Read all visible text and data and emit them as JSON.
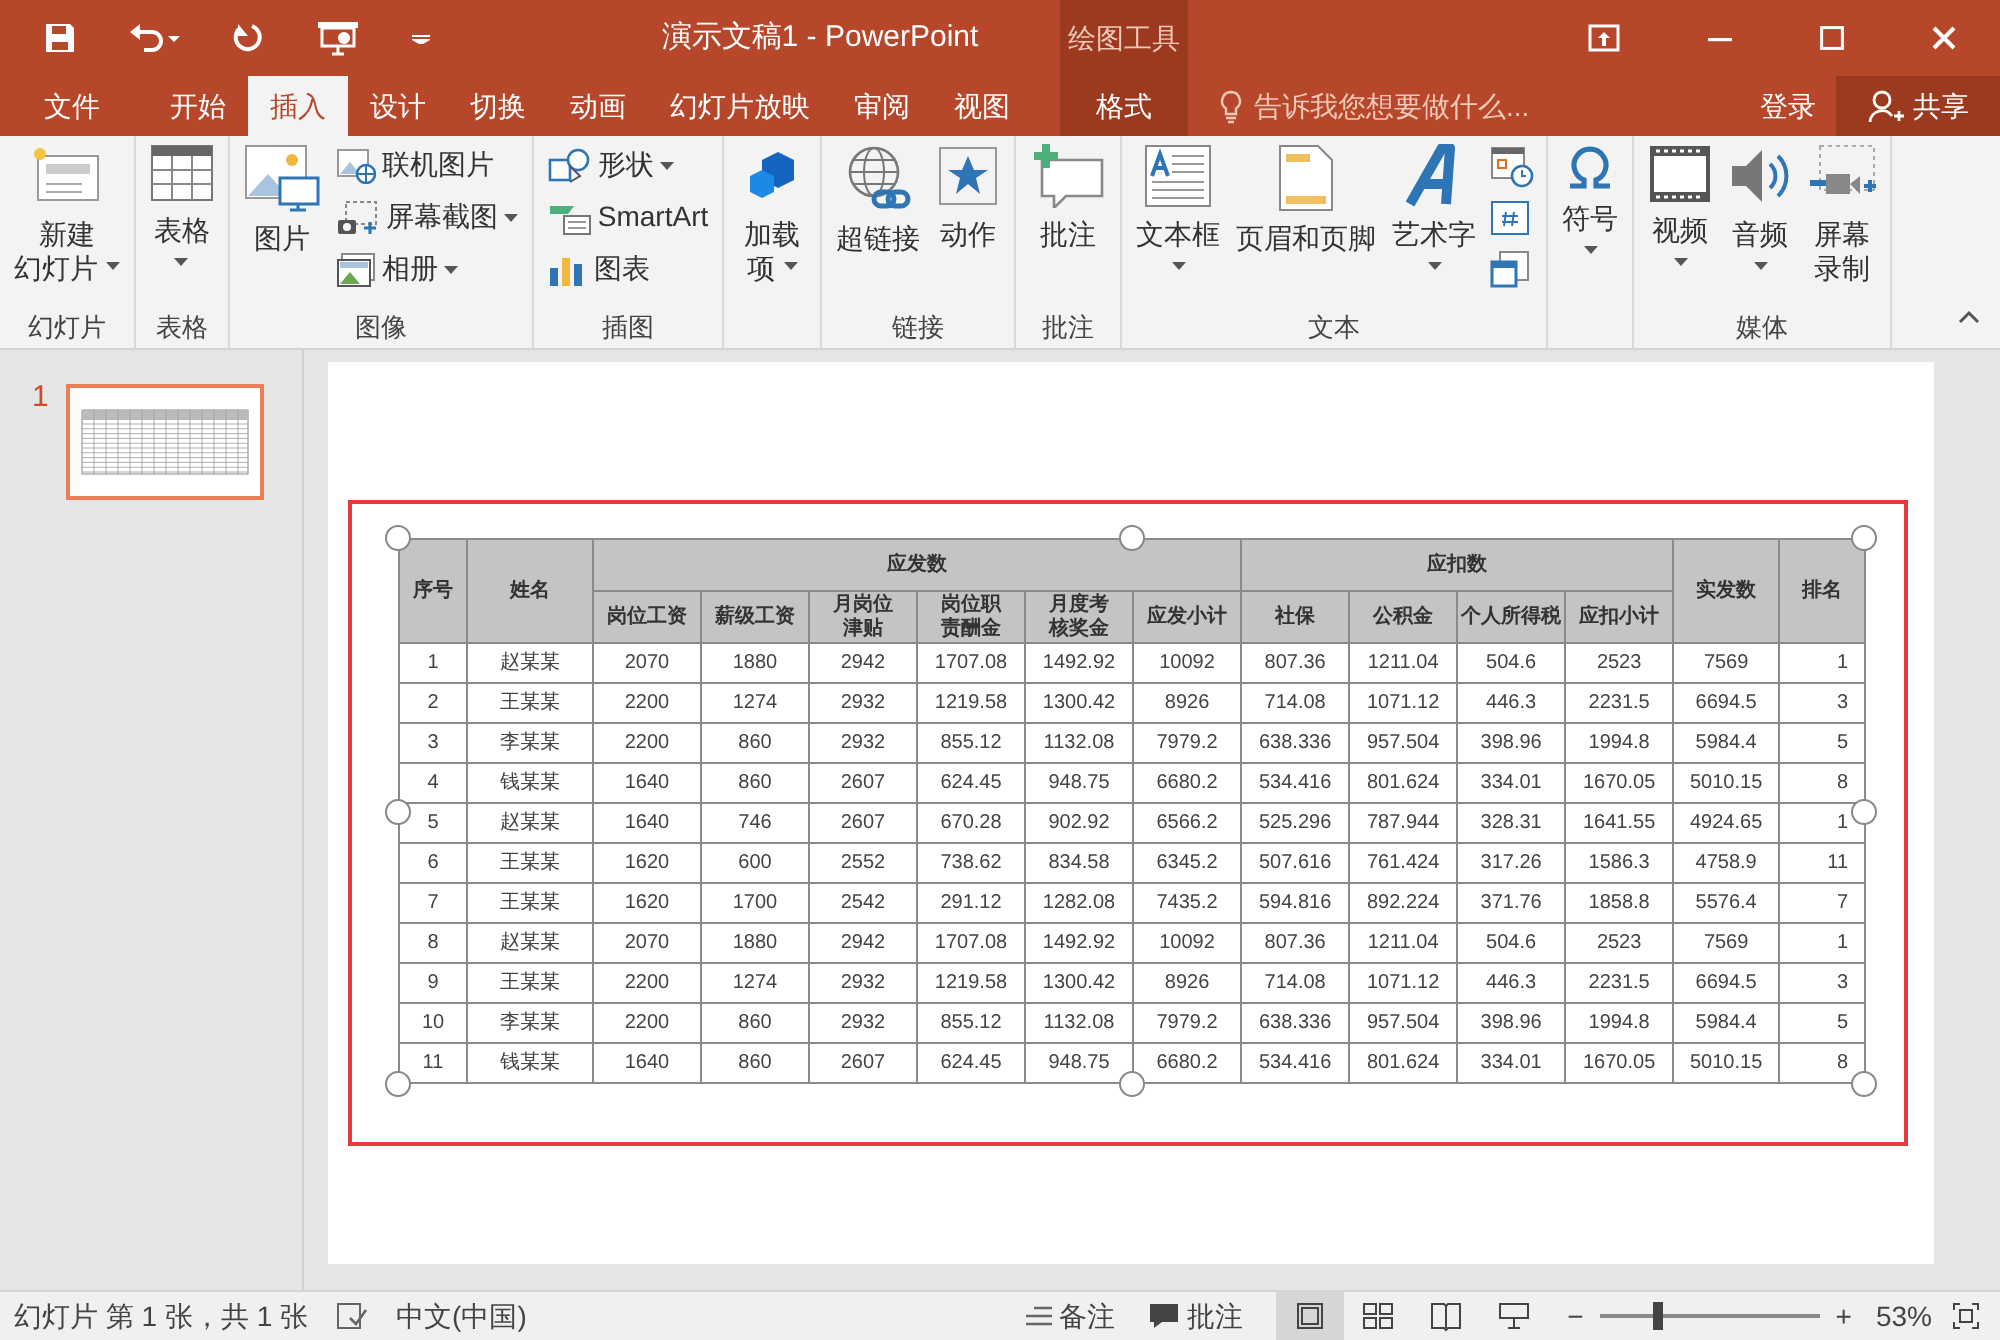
{
  "window": {
    "title": "演示文稿1 - PowerPoint",
    "context_group": "绘图工具"
  },
  "menu_tabs": [
    {
      "label": "文件",
      "selected": false,
      "kind": "file"
    },
    {
      "label": "开始",
      "selected": false,
      "kind": "tab"
    },
    {
      "label": "插入",
      "selected": true,
      "kind": "tab"
    },
    {
      "label": "设计",
      "selected": false,
      "kind": "tab"
    },
    {
      "label": "切换",
      "selected": false,
      "kind": "tab"
    },
    {
      "label": "动画",
      "selected": false,
      "kind": "tab"
    },
    {
      "label": "幻灯片放映",
      "selected": false,
      "kind": "tab"
    },
    {
      "label": "审阅",
      "selected": false,
      "kind": "tab"
    },
    {
      "label": "视图",
      "selected": false,
      "kind": "tab"
    },
    {
      "label": "格式",
      "selected": false,
      "kind": "context"
    }
  ],
  "tell_me": {
    "placeholder": "告诉我您想要做什么..."
  },
  "sign_in": "登录",
  "share": "共享",
  "ribbon_groups": [
    {
      "label": "幻灯片",
      "items": [
        {
          "kind": "large",
          "lines": [
            "新建",
            "幻灯片"
          ],
          "dropdown": true
        }
      ]
    },
    {
      "label": "表格",
      "items": [
        {
          "kind": "large",
          "lines": [
            "表格"
          ],
          "dropdown": true
        }
      ]
    },
    {
      "label": "图像",
      "items": [
        {
          "kind": "large",
          "lines": [
            "图片"
          ],
          "dropdown": false
        },
        {
          "kind": "small",
          "lines": [
            "联机图片"
          ],
          "dropdown": false
        },
        {
          "kind": "small",
          "lines": [
            "屏幕截图"
          ],
          "dropdown": true
        },
        {
          "kind": "small",
          "lines": [
            "相册"
          ],
          "dropdown": true
        }
      ]
    },
    {
      "label": "插图",
      "items": [
        {
          "kind": "small",
          "lines": [
            "形状"
          ],
          "dropdown": true
        },
        {
          "kind": "small",
          "lines": [
            "SmartArt"
          ],
          "dropdown": false
        },
        {
          "kind": "small",
          "lines": [
            "图表"
          ],
          "dropdown": false
        }
      ]
    },
    {
      "items": [
        {
          "kind": "large",
          "lines": [
            "加载",
            "项"
          ],
          "dropdown": true
        }
      ]
    },
    {
      "label": "链接",
      "items": [
        {
          "kind": "large",
          "lines": [
            "超链接"
          ],
          "dropdown": false
        },
        {
          "kind": "large",
          "lines": [
            "动作"
          ],
          "dropdown": false
        }
      ]
    },
    {
      "label": "批注",
      "items": [
        {
          "kind": "large",
          "lines": [
            "批注"
          ],
          "dropdown": false
        }
      ]
    },
    {
      "label": "文本",
      "items": [
        {
          "kind": "large",
          "lines": [
            "文本框"
          ],
          "dropdown": true
        },
        {
          "kind": "large",
          "lines": [
            "页眉和页脚"
          ],
          "dropdown": false
        },
        {
          "kind": "large",
          "lines": [
            "艺术字"
          ],
          "dropdown": true
        },
        {
          "kind": "icon"
        },
        {
          "kind": "icon"
        },
        {
          "kind": "icon"
        }
      ]
    },
    {
      "items": [
        {
          "kind": "large",
          "lines": [
            "符号"
          ],
          "dropdown": true
        }
      ]
    },
    {
      "label": "媒体",
      "items": [
        {
          "kind": "large",
          "lines": [
            "视频"
          ],
          "dropdown": true
        },
        {
          "kind": "large",
          "lines": [
            "音频"
          ],
          "dropdown": true
        },
        {
          "kind": "large",
          "lines": [
            "屏幕",
            "录制"
          ],
          "dropdown": false
        }
      ]
    }
  ],
  "slides": [
    {
      "number": "1",
      "selected": true
    }
  ],
  "table": {
    "header_rows": [
      [
        {
          "lines": [
            "序号"
          ],
          "rowspan": 2
        },
        {
          "lines": [
            "姓名"
          ],
          "rowspan": 2
        },
        {
          "lines": [
            "应发数"
          ],
          "colspan": 6
        },
        {
          "lines": [
            "应扣数"
          ],
          "colspan": 4
        },
        {
          "lines": [
            "实发数"
          ],
          "rowspan": 2
        },
        {
          "lines": [
            "排名"
          ],
          "rowspan": 2
        }
      ],
      [
        {
          "lines": [
            "岗位工资"
          ]
        },
        {
          "lines": [
            "薪级工资"
          ]
        },
        {
          "lines": [
            "月岗位",
            "津贴"
          ]
        },
        {
          "lines": [
            "岗位职",
            "责酬金"
          ]
        },
        {
          "lines": [
            "月度考",
            "核奖金"
          ]
        },
        {
          "lines": [
            "应发小计"
          ]
        },
        {
          "lines": [
            "社保"
          ]
        },
        {
          "lines": [
            "公积金"
          ]
        },
        {
          "lines": [
            "个人所得税"
          ]
        },
        {
          "lines": [
            "应扣小计"
          ]
        }
      ]
    ],
    "rows": [
      [
        "1",
        "赵某某",
        "2070",
        "1880",
        "2942",
        "1707.08",
        "1492.92",
        "10092",
        "807.36",
        "1211.04",
        "504.6",
        "2523",
        "7569",
        "1"
      ],
      [
        "2",
        "王某某",
        "2200",
        "1274",
        "2932",
        "1219.58",
        "1300.42",
        "8926",
        "714.08",
        "1071.12",
        "446.3",
        "2231.5",
        "6694.5",
        "3"
      ],
      [
        "3",
        "李某某",
        "2200",
        "860",
        "2932",
        "855.12",
        "1132.08",
        "7979.2",
        "638.336",
        "957.504",
        "398.96",
        "1994.8",
        "5984.4",
        "5"
      ],
      [
        "4",
        "钱某某",
        "1640",
        "860",
        "2607",
        "624.45",
        "948.75",
        "6680.2",
        "534.416",
        "801.624",
        "334.01",
        "1670.05",
        "5010.15",
        "8"
      ],
      [
        "5",
        "赵某某",
        "1640",
        "746",
        "2607",
        "670.28",
        "902.92",
        "6566.2",
        "525.296",
        "787.944",
        "328.31",
        "1641.55",
        "4924.65",
        "1"
      ],
      [
        "6",
        "王某某",
        "1620",
        "600",
        "2552",
        "738.62",
        "834.58",
        "6345.2",
        "507.616",
        "761.424",
        "317.26",
        "1586.3",
        "4758.9",
        "11"
      ],
      [
        "7",
        "王某某",
        "1620",
        "1700",
        "2542",
        "291.12",
        "1282.08",
        "7435.2",
        "594.816",
        "892.224",
        "371.76",
        "1858.8",
        "5576.4",
        "7"
      ],
      [
        "8",
        "赵某某",
        "2070",
        "1880",
        "2942",
        "1707.08",
        "1492.92",
        "10092",
        "807.36",
        "1211.04",
        "504.6",
        "2523",
        "7569",
        "1"
      ],
      [
        "9",
        "王某某",
        "2200",
        "1274",
        "2932",
        "1219.58",
        "1300.42",
        "8926",
        "714.08",
        "1071.12",
        "446.3",
        "2231.5",
        "6694.5",
        "3"
      ],
      [
        "10",
        "李某某",
        "2200",
        "860",
        "2932",
        "855.12",
        "1132.08",
        "7979.2",
        "638.336",
        "957.504",
        "398.96",
        "1994.8",
        "5984.4",
        "5"
      ],
      [
        "11",
        "钱某某",
        "1640",
        "860",
        "2607",
        "624.45",
        "948.75",
        "6680.2",
        "534.416",
        "801.624",
        "334.01",
        "1670.05",
        "5010.15",
        "8"
      ]
    ]
  },
  "status_bar": {
    "slide_info": "幻灯片 第 1 张，共 1 张",
    "language": "中文(中国)",
    "notes": "备注",
    "comments": "批注",
    "views": [
      {
        "selected": true
      },
      {
        "selected": false
      },
      {
        "selected": false
      },
      {
        "selected": false
      }
    ],
    "zoom_out": "−",
    "zoom_in": "+",
    "zoom": {
      "level": 0.27,
      "reading": "53%"
    }
  }
}
